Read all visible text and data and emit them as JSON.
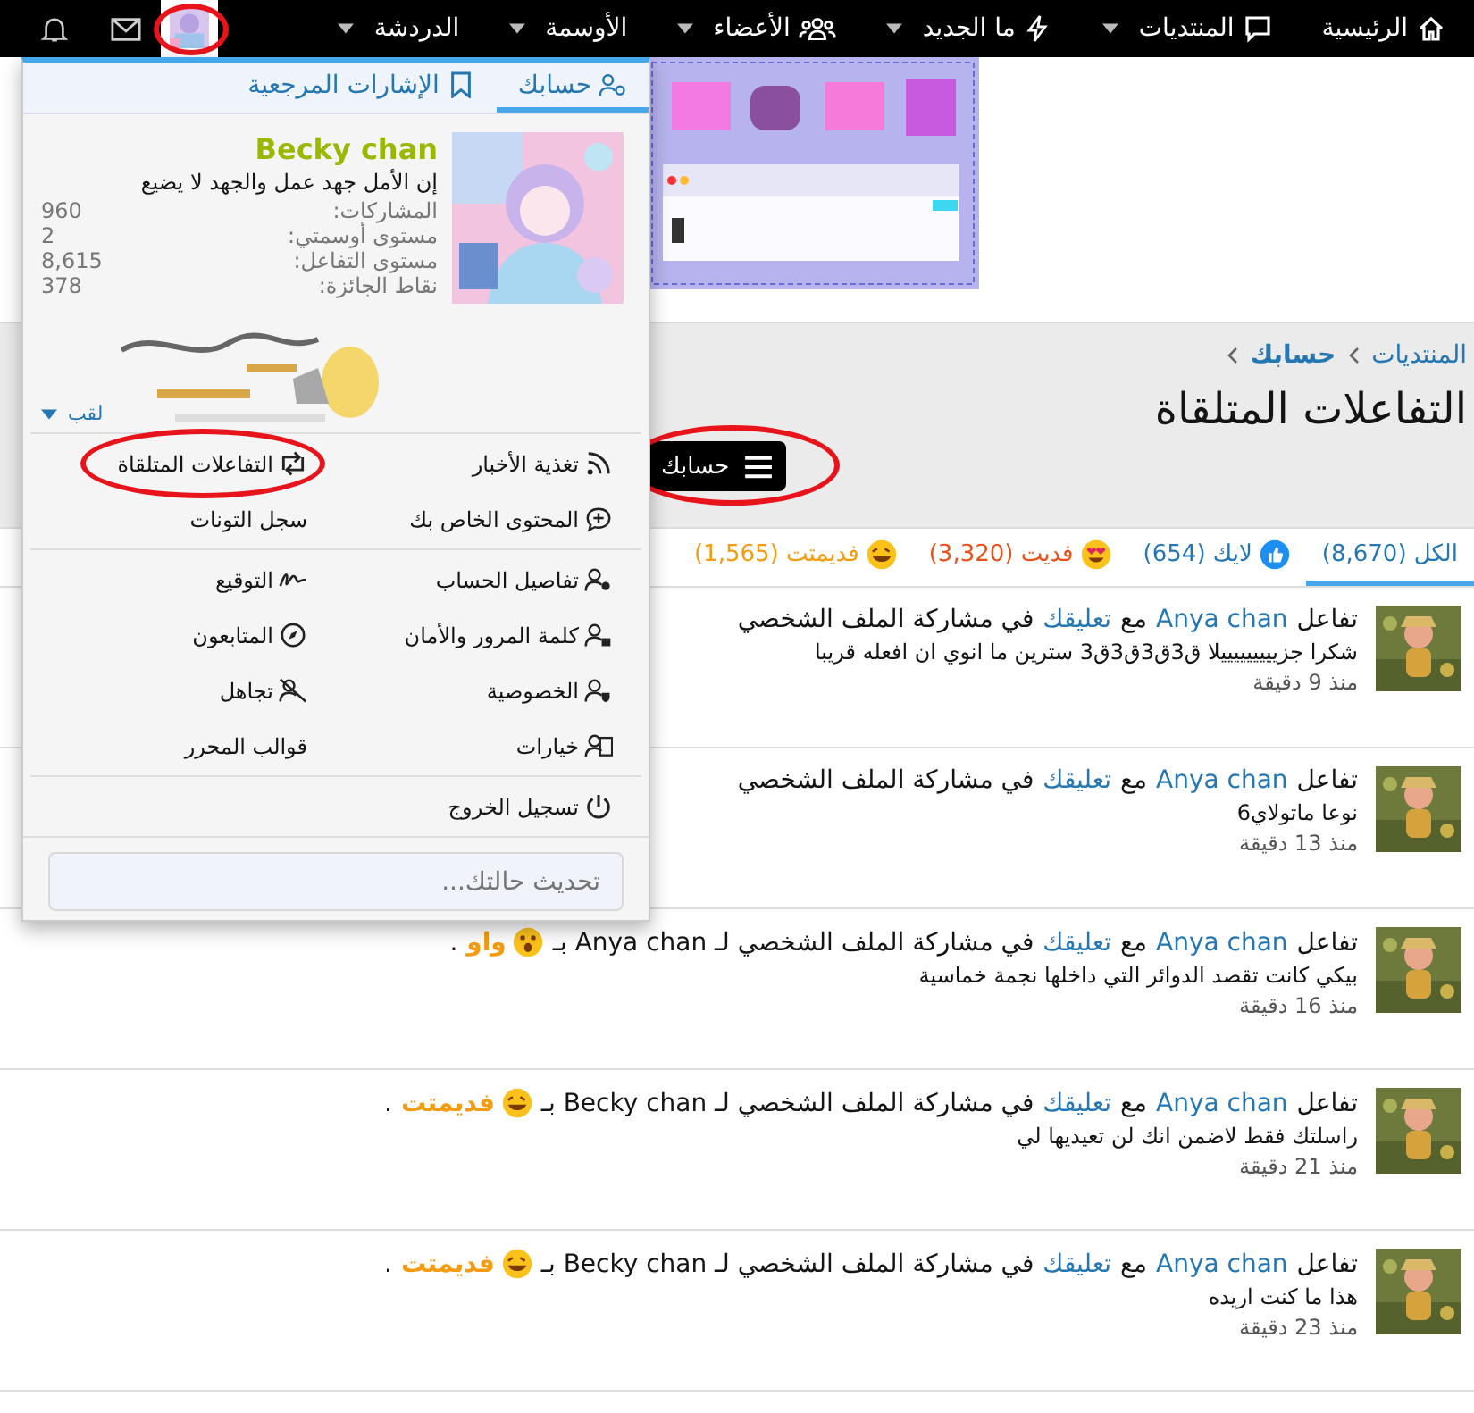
{
  "navbar": {
    "items": [
      {
        "label": "الرئيسية"
      },
      {
        "label": "المنتديات"
      },
      {
        "label": "ما الجديد"
      },
      {
        "label": "الأعضاء"
      },
      {
        "label": "الأوسمة"
      },
      {
        "label": "الدردشة"
      }
    ],
    "user_menu": {
      "open": true,
      "circled": true
    }
  },
  "breadcrumb": [
    "المنتديات",
    "حسابك"
  ],
  "page_title": "التفاعلات المتلقاة",
  "account_button": {
    "label": "حسابك",
    "circled": true
  },
  "reaction_tabs": [
    {
      "label": "الكل (8,670)",
      "color": "#2577b1",
      "selected": true
    },
    {
      "label": "لايك (654)",
      "color": "#2577b1",
      "selected": false
    },
    {
      "label": "فديت (3,320)",
      "color": "#e8511a",
      "selected": false
    },
    {
      "label": "فديمتت (1,565)",
      "color": "#f39c12",
      "selected": false
    }
  ],
  "alerts": [
    {
      "parts": [
        {
          "kind": "text",
          "text": "تفاعل"
        },
        {
          "kind": "link",
          "text": "Anya chan"
        },
        {
          "kind": "text",
          "text": "مع"
        },
        {
          "kind": "link",
          "text": "تعليقك"
        },
        {
          "kind": "text",
          "text": "في مشاركة الملف الشخصي"
        }
      ],
      "snippet": "شكرا جزيييييييييلا ق3ق3ق3ق3 سترين ما انوي ان افعله قريبا",
      "time": "منذ 9 دقيقة"
    },
    {
      "parts": [
        {
          "kind": "text",
          "text": "تفاعل"
        },
        {
          "kind": "link",
          "text": "Anya chan"
        },
        {
          "kind": "text",
          "text": "مع"
        },
        {
          "kind": "link",
          "text": "تعليقك"
        },
        {
          "kind": "text",
          "text": "في مشاركة الملف الشخصي"
        }
      ],
      "snippet": "نوعا ماتولاي6",
      "time": "منذ 13 دقيقة"
    },
    {
      "parts": [
        {
          "kind": "text",
          "text": "تفاعل"
        },
        {
          "kind": "link",
          "text": "Anya chan"
        },
        {
          "kind": "text",
          "text": "مع"
        },
        {
          "kind": "link",
          "text": "تعليقك"
        },
        {
          "kind": "text",
          "text": "في مشاركة الملف الشخصي لـ Anya chan بـ"
        },
        {
          "kind": "wow",
          "text": "واو"
        },
        {
          "kind": "text",
          "text": "."
        }
      ],
      "snippet": "بيكي كانت تقصد الدوائر التي داخلها نجمة خماسية",
      "time": "منذ 16 دقيقة"
    },
    {
      "parts": [
        {
          "kind": "text",
          "text": "تفاعل"
        },
        {
          "kind": "link",
          "text": "Anya chan"
        },
        {
          "kind": "text",
          "text": "مع"
        },
        {
          "kind": "link",
          "text": "تعليقك"
        },
        {
          "kind": "text",
          "text": "في مشاركة الملف الشخصي لـ Becky chan بـ"
        },
        {
          "kind": "laugh",
          "text": "فديمتت"
        },
        {
          "kind": "text",
          "text": "."
        }
      ],
      "snippet": "راسلتك فقط لاضمن انك لن تعيديها لي",
      "time": "منذ 21 دقيقة"
    },
    {
      "parts": [
        {
          "kind": "text",
          "text": "تفاعل"
        },
        {
          "kind": "link",
          "text": "Anya chan"
        },
        {
          "kind": "text",
          "text": "مع"
        },
        {
          "kind": "link",
          "text": "تعليقك"
        },
        {
          "kind": "text",
          "text": "في مشاركة الملف الشخصي لـ Becky chan بـ"
        },
        {
          "kind": "laugh",
          "text": "فديمتت"
        },
        {
          "kind": "text",
          "text": "."
        }
      ],
      "snippet": "هذا ما كنت اريده",
      "time": "منذ 23 دقيقة"
    }
  ],
  "account_menu": {
    "tabs": [
      {
        "label": "حسابك",
        "selected": true
      },
      {
        "label": "الإشارات المرجعية",
        "selected": false
      }
    ],
    "profile": {
      "name": "Becky chan",
      "status": "إن الأمل جهد عمل والجهد لا يضيع",
      "stats": [
        {
          "label": "المشاركات:",
          "value": "960"
        },
        {
          "label": "مستوى أوسمتي:",
          "value": "2"
        },
        {
          "label": "مستوى التفاعل:",
          "value": "8,615"
        },
        {
          "label": "نقاط الجائزة:",
          "value": "378"
        }
      ],
      "title_link": "لقب"
    },
    "sections": [
      {
        "items": [
          {
            "label": "تغذية الأخبار",
            "circled": false
          },
          {
            "label": "التفاعلات المتلقاة",
            "circled": true
          },
          {
            "label": "المحتوى الخاص بك",
            "circled": false
          },
          {
            "label": "سجل التونات",
            "circled": false
          }
        ]
      },
      {
        "items": [
          {
            "label": "تفاصيل الحساب",
            "circled": false
          },
          {
            "label": "التوقيع",
            "circled": false
          },
          {
            "label": "كلمة المرور والأمان",
            "circled": false
          },
          {
            "label": "المتابعون",
            "circled": false
          },
          {
            "label": "الخصوصية",
            "circled": false
          },
          {
            "label": "تجاهل",
            "circled": false
          },
          {
            "label": "خيارات",
            "circled": false
          },
          {
            "label": "قوالب المحرر",
            "circled": false
          }
        ]
      },
      {
        "items": [
          {
            "label": "تسجيل الخروج",
            "circled": false
          }
        ]
      }
    ],
    "status_field": {
      "placeholder": "تحديث حالتك..."
    }
  }
}
